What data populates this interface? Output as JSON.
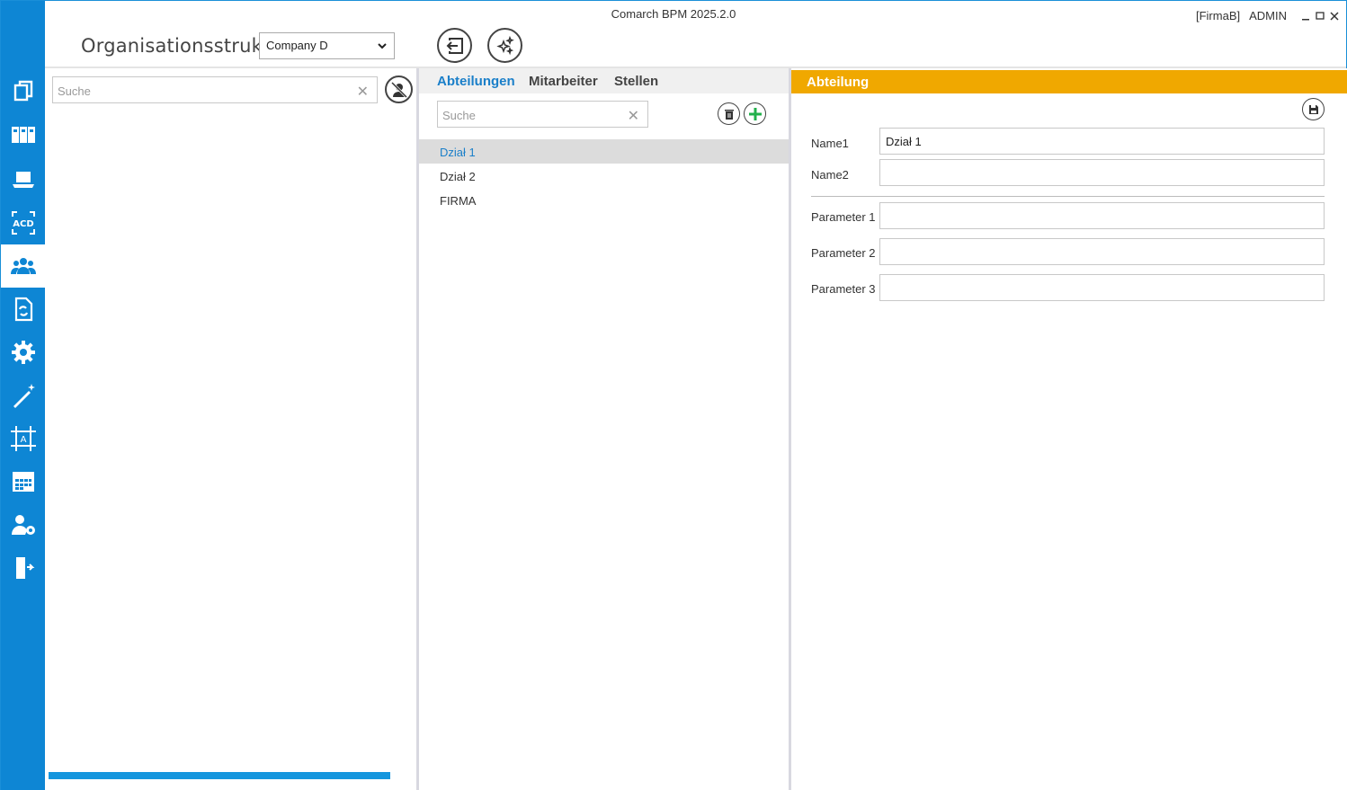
{
  "window": {
    "title": "Comarch BPM 2025.2.0",
    "company_tag": "[FirmaB]",
    "user": "ADMIN"
  },
  "header": {
    "page_title": "Organisationsstruktur",
    "company_select_value": "Company D"
  },
  "sidebar": {
    "items": [
      {
        "icon": "documents-icon"
      },
      {
        "icon": "binders-icon"
      },
      {
        "icon": "laptop-icon"
      },
      {
        "icon": "acd-icon"
      },
      {
        "icon": "users-group-icon",
        "active": true
      },
      {
        "icon": "document-sync-icon"
      },
      {
        "icon": "gear-icon"
      },
      {
        "icon": "magic-wand-icon"
      },
      {
        "icon": "design-frame-icon"
      },
      {
        "icon": "calendar-icon"
      },
      {
        "icon": "user-settings-icon"
      },
      {
        "icon": "logout-door-icon"
      }
    ]
  },
  "left_panel": {
    "search_placeholder": "Suche",
    "progress": 1.0
  },
  "mid_panel": {
    "tabs": [
      {
        "label": "Abteilungen",
        "active": true
      },
      {
        "label": "Mitarbeiter"
      },
      {
        "label": "Stellen"
      }
    ],
    "search_placeholder": "Suche",
    "items": [
      "Dział 1",
      "Dział 2",
      "FIRMA"
    ],
    "selected_index": 0
  },
  "right_panel": {
    "section_title": "Abteilung",
    "fields": [
      {
        "label": "Name1",
        "value": "Dział 1"
      },
      {
        "label": "Name2",
        "value": ""
      },
      {
        "label": "Parameter 1",
        "value": ""
      },
      {
        "label": "Parameter 2",
        "value": ""
      },
      {
        "label": "Parameter 3",
        "value": ""
      }
    ]
  },
  "colors": {
    "sidebar": "#0e86d4",
    "accent_blue": "#1a7fc9",
    "section_header": "#f0a800",
    "add_green": "#22b04b"
  }
}
